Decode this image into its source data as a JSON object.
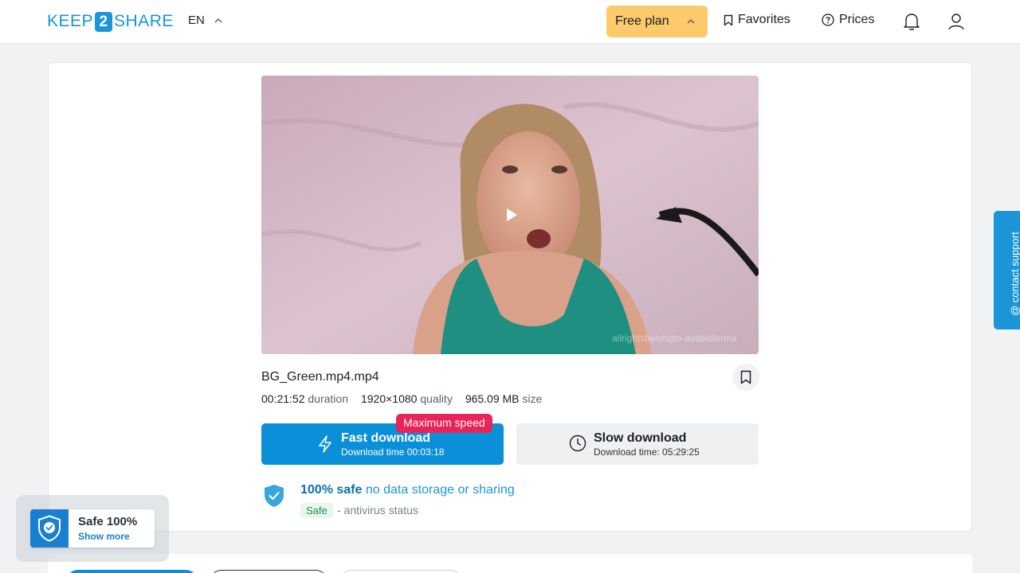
{
  "header": {
    "logo": {
      "left": "KEEP",
      "num": "2",
      "right": "SHARE"
    },
    "language": "EN",
    "plan_label": "Free plan",
    "favorites_label": "Favorites",
    "prices_label": "Prices"
  },
  "video": {
    "watermark": "allrightsbelongto-avaballerina"
  },
  "file": {
    "name": "BG_Green.mp4.mp4",
    "duration_value": "00:21:52",
    "duration_label": "duration",
    "quality_value": "1920×1080",
    "quality_label": "quality",
    "size_value": "965.09 MB",
    "size_label": "size"
  },
  "download": {
    "max_speed_badge": "Maximum speed",
    "fast_label": "Fast download",
    "fast_time": "Download time 00:03:18",
    "slow_label": "Slow download",
    "slow_time": "Download time: 05:29:25"
  },
  "safety": {
    "strong": "100% safe",
    "rest": " no data storage or sharing",
    "tag": "Safe",
    "status": "- antivirus status"
  },
  "support": {
    "label": "@ contact support"
  },
  "safe_badge": {
    "title": "Safe 100%",
    "link": "Show more"
  },
  "colors": {
    "accent": "#0b8fd9",
    "plan": "#fcc96b",
    "badge": "#e8245a"
  }
}
